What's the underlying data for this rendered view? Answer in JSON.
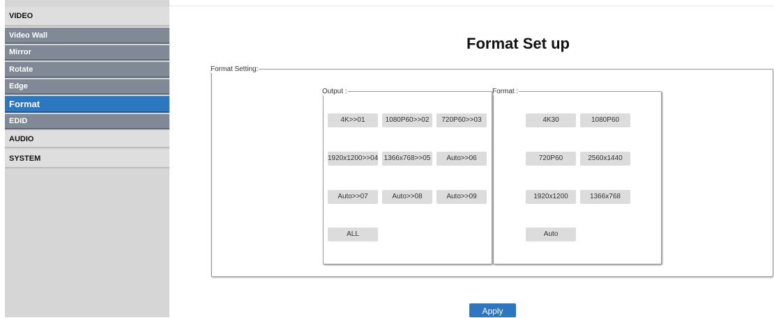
{
  "sidebar": {
    "video": "VIDEO",
    "video_wall": "Video Wall",
    "mirror": "Mirror",
    "rotate": "Rotate",
    "edge": "Edge",
    "format": "Format",
    "edid": "EDID",
    "audio": "AUDIO",
    "system": "SYSTEM"
  },
  "main": {
    "title": "Format Set up",
    "format_setting_legend": "Format Setting:",
    "output": {
      "legend": "Output :",
      "buttons": [
        "4K>>01",
        "1080P60>>02",
        "720P60>>03",
        "1920x1200>>04",
        "1366x768>>05",
        "Auto>>06",
        "Auto>>07",
        "Auto>>08",
        "Auto>>09",
        "ALL"
      ]
    },
    "format": {
      "legend": "Format :",
      "buttons": [
        "4K30",
        "1080P60",
        "720P60",
        "2560x1440",
        "1920x1200",
        "1366x768",
        "Auto"
      ]
    },
    "apply_label": "Apply"
  },
  "colors": {
    "accent": "#2d76c0",
    "sidebar_sub": "#808a96",
    "button_bg": "#dcdcdc"
  }
}
